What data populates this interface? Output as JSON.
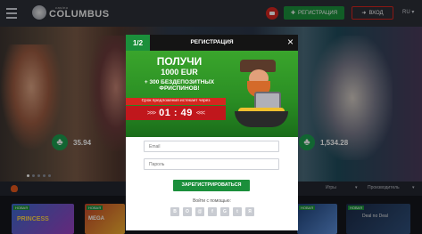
{
  "header": {
    "logo_small": "casino",
    "logo_big": "COLUMBUS",
    "register_label": "РЕГИСТРАЦИЯ",
    "login_label": "ВХОД",
    "language": "RU"
  },
  "slider": {
    "jackpot_left": "35.94",
    "jackpot_right": "1,534.28"
  },
  "filterbar": {
    "games_label": "Игры",
    "providers_label": "Производитель"
  },
  "tiles": [
    {
      "tag": "НОВАЯ",
      "label": "PRINCESS"
    },
    {
      "tag": "НОВАЯ",
      "label": "MEGA"
    },
    {
      "tag": "НОВАЯ",
      "label": ""
    },
    {
      "tag": "НОВАЯ",
      "label": "Deal no Deal"
    }
  ],
  "modal": {
    "step": "1/2",
    "title": "РЕГИСТРАЦИЯ",
    "promo": {
      "line1": "ПОЛУЧИ",
      "line2": "1000 EUR",
      "line3": "+ 300 БЕЗДЕПОЗИТНЫХ",
      "line4": "ФРИСПИНОВ!",
      "timer_caption": "Срок предложения истекает через",
      "timer_arrows_left": ">>>",
      "timer_arrows_right": "<<<",
      "timer_value": "01 : 49"
    },
    "form": {
      "email_placeholder": "Email",
      "password_placeholder": "Пароль",
      "submit_label": "ЗАРЕГИСТРИРОВАТЬСЯ",
      "social_label": "Войти с помощью:",
      "socials": [
        "vk-icon",
        "ok-icon",
        "mailru-icon",
        "facebook-icon",
        "google-icon",
        "twitter-icon",
        "yandex-icon"
      ],
      "social_glyphs": [
        "B",
        "O",
        "@",
        "f",
        "G",
        "t",
        "Я"
      ]
    }
  }
}
